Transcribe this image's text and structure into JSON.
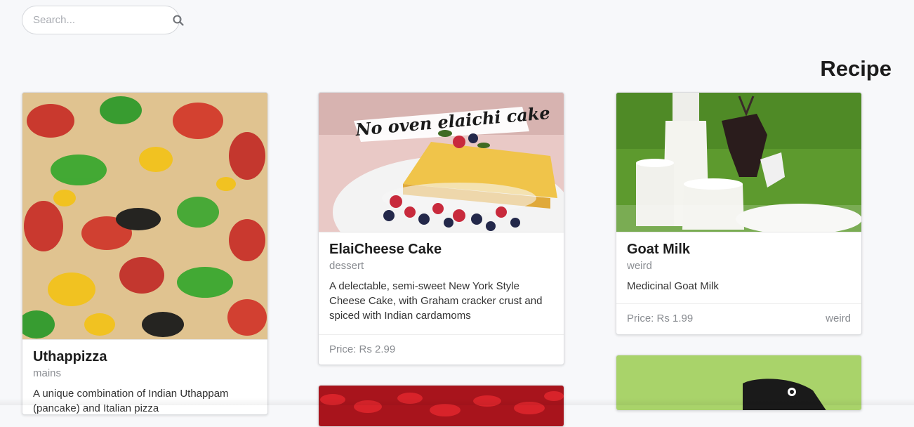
{
  "search": {
    "placeholder": "Search...",
    "value": ""
  },
  "page": {
    "title": "Recipe"
  },
  "cards": [
    {
      "name": "Uthappizza",
      "category": "mains",
      "description": "A unique combination of Indian Uthappam (pancake) and Italian pizza",
      "price": "",
      "tag": ""
    },
    {
      "name": "ElaiCheese Cake",
      "category": "dessert",
      "description": "A delectable, semi-sweet New York Style Cheese Cake, with Graham cracker crust and spiced with Indian cardamoms",
      "price": "Price: Rs 2.99",
      "tag": "",
      "image_caption": "No oven elaichi cake"
    },
    {
      "name": "Goat Milk",
      "category": "weird",
      "description": "Medicinal Goat Milk",
      "price": "Price: Rs 1.99",
      "tag": "weird"
    }
  ],
  "colors": {
    "background": "#f7f8fa",
    "card_border": "#dcdde0",
    "muted_text": "#8a8d92"
  }
}
